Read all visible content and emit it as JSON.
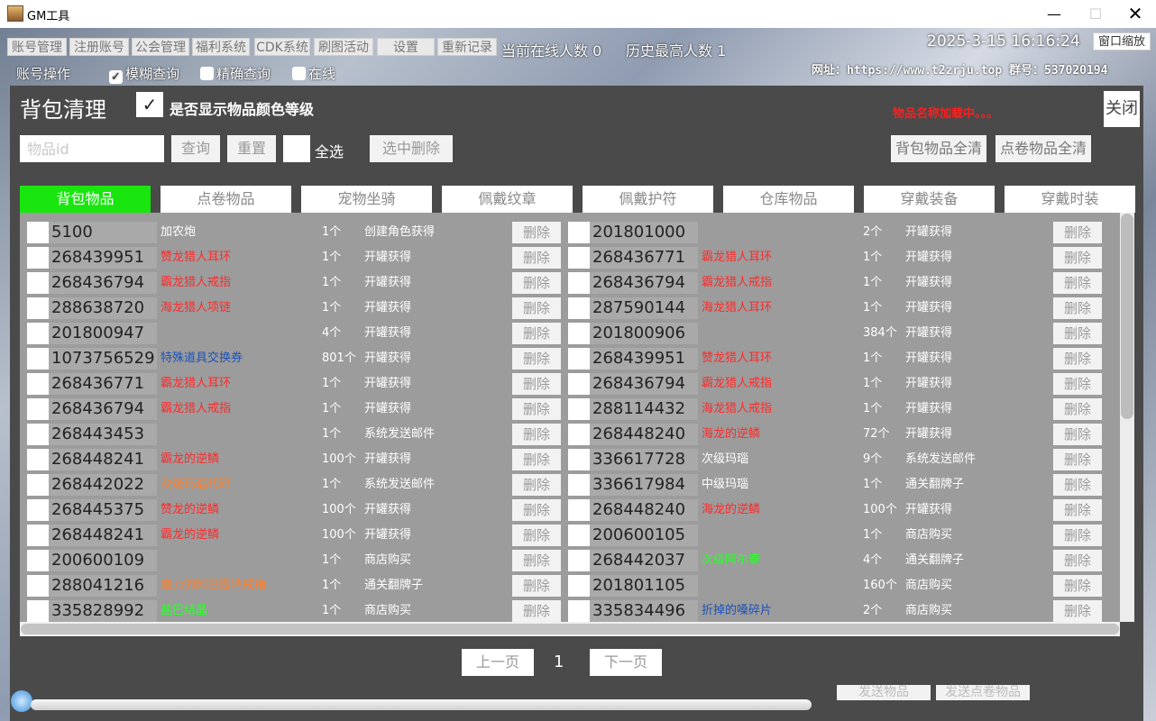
{
  "window": {
    "title": "GM工具",
    "minimize": "—",
    "maximize": "☐",
    "close": "✕"
  },
  "menu": [
    "账号管理",
    "注册账号",
    "公会管理",
    "福利系统",
    "CDK系统",
    "刷图活动",
    "设置",
    "重新记录"
  ],
  "top": {
    "online_text": "当前在线人数 0",
    "max_text": "历史最高人数 1",
    "datetime": "2025-3-15 16:16:24",
    "zoom_button": "窗口缩放",
    "site": "网址：https://www.t2zrju.top 群号：537020194",
    "account_ops": "账号操作",
    "fuzzy_query": "模糊查询",
    "exact_query": "精确查询",
    "online_filter": "在线"
  },
  "dialog": {
    "title": "背包清理",
    "color_check": "✓",
    "show_color_label": "是否显示物品颜色等级",
    "loading": "物品名称加载中。。。",
    "close": "关闭",
    "item_id_placeholder": "物品id",
    "query": "查询",
    "reset": "重置",
    "select_all": "全选",
    "delete_selected": "选中删除",
    "clear_bag": "背包物品全清",
    "clear_scroll": "点卷物品全清"
  },
  "tabs": [
    "背包物品",
    "点卷物品",
    "宠物坐骑",
    "佩戴纹章",
    "佩戴护符",
    "仓库物品",
    "穿戴装备",
    "穿戴时装"
  ],
  "active_tab": 0,
  "delete_label": "删除",
  "rows": [
    {
      "l": {
        "id": "5100",
        "name": "加农炮",
        "color": "#ffffff",
        "qty": "1个",
        "src": "创建角色获得"
      },
      "r": {
        "id": "201801000",
        "name": "",
        "color": "#ffffff",
        "qty": "2个",
        "src": "开罐获得"
      }
    },
    {
      "l": {
        "id": "268439951",
        "name": "赞龙猎人耳环",
        "color": "#ff2a2a",
        "qty": "1个",
        "src": "开罐获得"
      },
      "r": {
        "id": "268436771",
        "name": "霸龙猎人耳环",
        "color": "#ff2a2a",
        "qty": "1个",
        "src": "开罐获得"
      }
    },
    {
      "l": {
        "id": "268436794",
        "name": "霸龙猎人戒指",
        "color": "#ff2a2a",
        "qty": "1个",
        "src": "开罐获得"
      },
      "r": {
        "id": "268436794",
        "name": "霸龙猎人戒指",
        "color": "#ff2a2a",
        "qty": "1个",
        "src": "开罐获得"
      }
    },
    {
      "l": {
        "id": "288638720",
        "name": "海龙猎人项链",
        "color": "#ff2a2a",
        "qty": "1个",
        "src": "开罐获得"
      },
      "r": {
        "id": "287590144",
        "name": "海龙猎人耳环",
        "color": "#ff2a2a",
        "qty": "1个",
        "src": "开罐获得"
      }
    },
    {
      "l": {
        "id": "201800947",
        "name": "",
        "color": "#ffffff",
        "qty": "4个",
        "src": "开罐获得"
      },
      "r": {
        "id": "201800906",
        "name": "",
        "color": "#ffffff",
        "qty": "384个",
        "src": "开罐获得"
      }
    },
    {
      "l": {
        "id": "1073756529",
        "name": "特殊道具交换券",
        "color": "#1d52b8",
        "qty": "801个",
        "src": "开罐获得"
      },
      "r": {
        "id": "268439951",
        "name": "赞龙猎人耳环",
        "color": "#ff2a2a",
        "qty": "1个",
        "src": "开罐获得"
      }
    },
    {
      "l": {
        "id": "268436771",
        "name": "霸龙猎人耳环",
        "color": "#ff2a2a",
        "qty": "1个",
        "src": "开罐获得"
      },
      "r": {
        "id": "268436794",
        "name": "霸龙猎人戒指",
        "color": "#ff2a2a",
        "qty": "1个",
        "src": "开罐获得"
      }
    },
    {
      "l": {
        "id": "268436794",
        "name": "霸龙猎人戒指",
        "color": "#ff2a2a",
        "qty": "1个",
        "src": "开罐获得"
      },
      "r": {
        "id": "288114432",
        "name": "海龙猎人戒指",
        "color": "#ff2a2a",
        "qty": "1个",
        "src": "开罐获得"
      }
    },
    {
      "l": {
        "id": "268443453",
        "name": "",
        "color": "#ffffff",
        "qty": "1个",
        "src": "系统发送邮件"
      },
      "r": {
        "id": "268448240",
        "name": "海龙的逆鳞",
        "color": "#ff2a2a",
        "qty": "72个",
        "src": "开罐获得"
      }
    },
    {
      "l": {
        "id": "268448241",
        "name": "霸龙的逆鳞",
        "color": "#ff2a2a",
        "qty": "100个",
        "src": "开罐获得"
      },
      "r": {
        "id": "336617728",
        "name": "次级玛瑙",
        "color": "#ffffff",
        "qty": "9个",
        "src": "系统发送邮件"
      }
    },
    {
      "l": {
        "id": "268442022",
        "name": "次级玛瑙代码",
        "color": "#ff7f2a",
        "qty": "1个",
        "src": "系统发送邮件"
      },
      "r": {
        "id": "336617984",
        "name": "中级玛瑙",
        "color": "#ffffff",
        "qty": "1个",
        "src": "通关翻牌子"
      }
    },
    {
      "l": {
        "id": "268445375",
        "name": "赞龙的逆鳞",
        "color": "#ff2a2a",
        "qty": "100个",
        "src": "开罐获得"
      },
      "r": {
        "id": "268448240",
        "name": "海龙的逆鳞",
        "color": "#ff2a2a",
        "qty": "100个",
        "src": "开罐获得"
      }
    },
    {
      "l": {
        "id": "268448241",
        "name": "霸龙的逆鳞",
        "color": "#ff2a2a",
        "qty": "100个",
        "src": "开罐获得"
      },
      "r": {
        "id": "200600105",
        "name": "",
        "color": "#ffffff",
        "qty": "1个",
        "src": "商店购买"
      }
    },
    {
      "l": {
        "id": "200600109",
        "name": "",
        "color": "#ffffff",
        "qty": "1个",
        "src": "商店购买"
      },
      "r": {
        "id": "268442037",
        "name": "次级阿尔泰",
        "color": "#2aff2a",
        "qty": "4个",
        "src": "通关翻牌子"
      }
    },
    {
      "l": {
        "id": "288041216",
        "name": "魔力的阿巴霞瑞戒指",
        "color": "#ff7f2a",
        "qty": "1个",
        "src": "通关翻牌子"
      },
      "r": {
        "id": "201801105",
        "name": "",
        "color": "#ffffff",
        "qty": "160个",
        "src": "商店购买"
      }
    },
    {
      "l": {
        "id": "335828992",
        "name": "盐巴结晶",
        "color": "#2aff2a",
        "qty": "1个",
        "src": "商店购买"
      },
      "r": {
        "id": "335834496",
        "name": "折掉的嗓碎片",
        "color": "#1d52b8",
        "qty": "2个",
        "src": "商店购买"
      }
    }
  ],
  "pager": {
    "prev": "上一页",
    "page": "1",
    "next": "下一页"
  },
  "bottom": {
    "send_item": "发送物品",
    "send_scroll_item": "发送点卷物品"
  }
}
